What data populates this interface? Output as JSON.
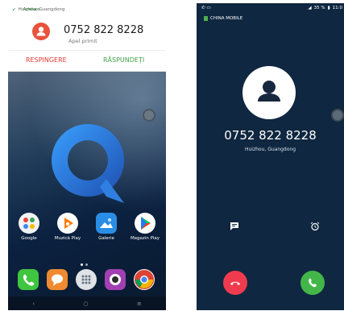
{
  "left": {
    "notification": {
      "app_label": "Apelare",
      "location": "Huizhou, Guangdong",
      "number": "0752 822 8228",
      "status": "Apel primit",
      "reject_label": "RESPINGERE",
      "answer_label": "RĂSPUNDEȚI"
    },
    "apps": [
      {
        "label": "Google",
        "icon": "google-folder-icon"
      },
      {
        "label": "Muzică Play",
        "icon": "play-music-icon"
      },
      {
        "label": "Galerie",
        "icon": "gallery-icon"
      },
      {
        "label": "Magazin Play",
        "icon": "play-store-icon"
      }
    ],
    "dock": [
      {
        "icon": "phone-icon",
        "color": "#3fc53f"
      },
      {
        "icon": "messages-icon",
        "color": "#f08a30"
      },
      {
        "icon": "app-drawer-icon",
        "color": "#dfe3e8"
      },
      {
        "icon": "camera-icon",
        "color": "#a23fb3"
      },
      {
        "icon": "chrome-icon",
        "color": "#ffffff"
      }
    ],
    "nav": {
      "back": "‹",
      "home": "○",
      "recent": "≡"
    }
  },
  "right": {
    "status": {
      "battery": "35 %",
      "time": "11:0"
    },
    "carrier": "CHINA MOBILE",
    "number": "0752 822 8228",
    "location": "Huizhou, Guangdong"
  },
  "colors": {
    "decline": "#ef3b4d",
    "accept": "#43b649",
    "notification_avatar": "#e8533b",
    "reject_text": "#e53935",
    "answer_text": "#43a047"
  }
}
